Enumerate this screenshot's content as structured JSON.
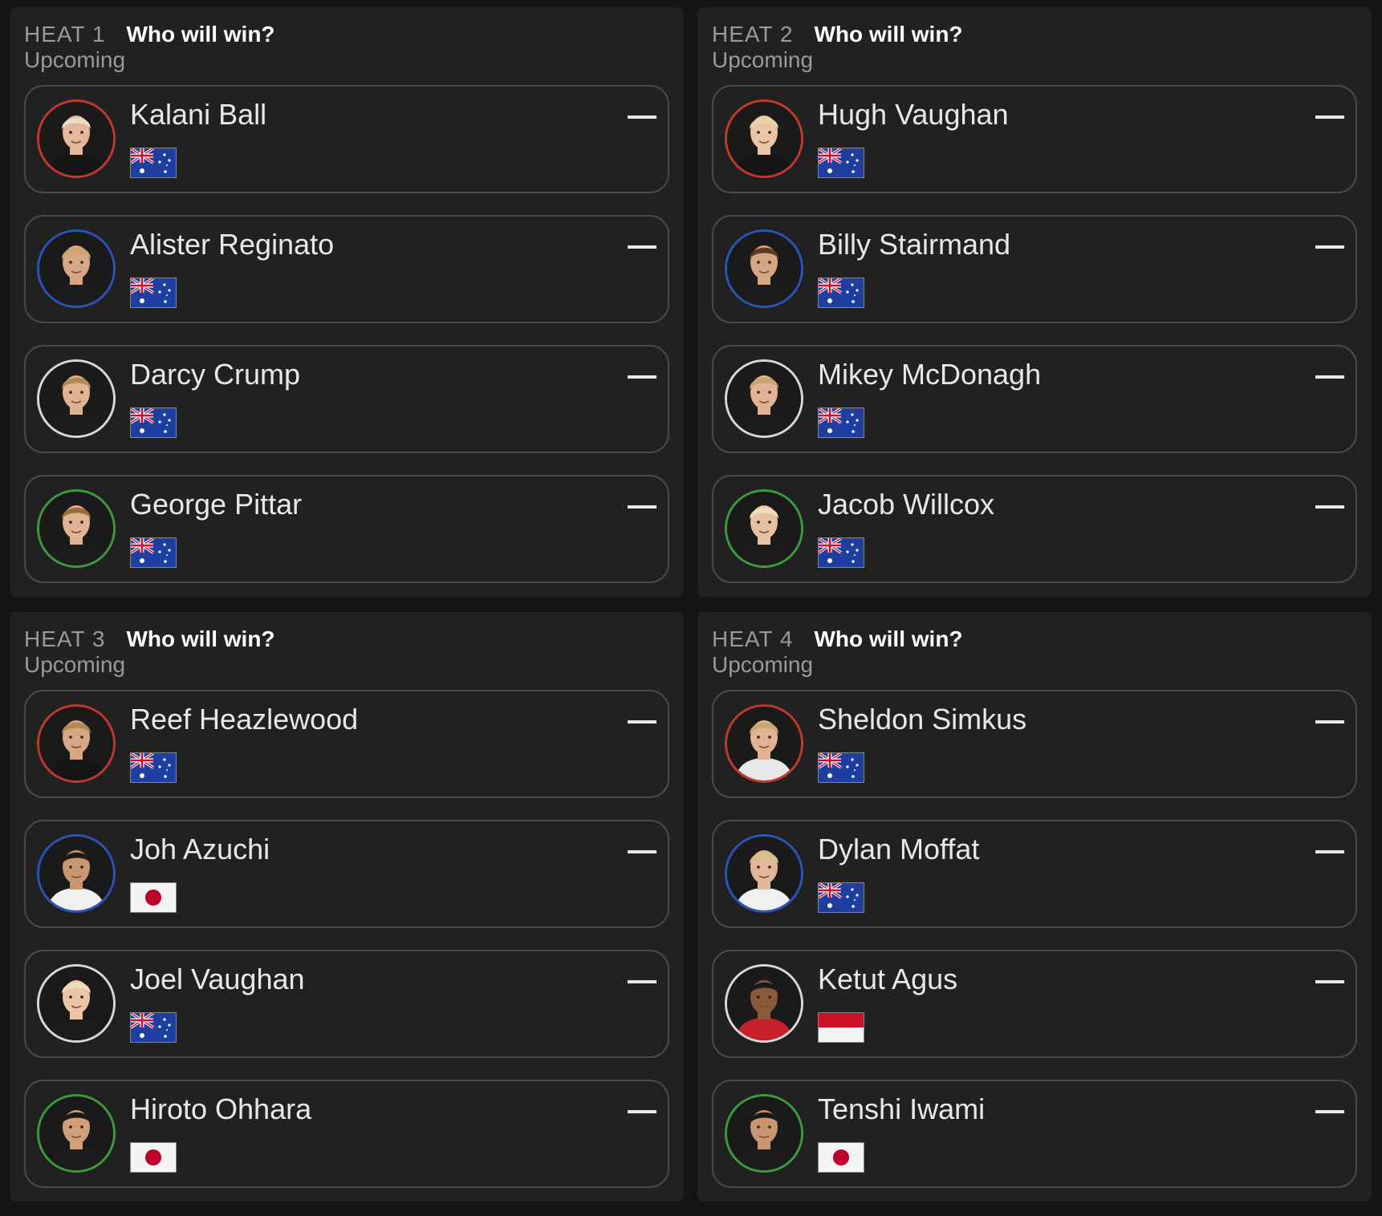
{
  "heats": [
    {
      "label": "HEAT 1",
      "question": "Who will win?",
      "status": "Upcoming",
      "surfers": [
        {
          "name": "Kalani Ball",
          "country": "Australia",
          "ring": "#c0392b",
          "skin": "#e2b79c",
          "hair": "#e8dcc0",
          "shirt": "#151515",
          "pick": "—"
        },
        {
          "name": "Alister Reginato",
          "country": "Australia",
          "ring": "#2a55b8",
          "skin": "#d7a684",
          "hair": "#c9a870",
          "shirt": "#1c1c1c",
          "pick": "—"
        },
        {
          "name": "Darcy Crump",
          "country": "Australia",
          "ring": "#d8d8d8",
          "skin": "#e0b394",
          "hair": "#b38a52",
          "shirt": "#1c1c1c",
          "pick": "—"
        },
        {
          "name": "George Pittar",
          "country": "Australia",
          "ring": "#3c9a3c",
          "skin": "#e0b394",
          "hair": "#9a6a3a",
          "shirt": "#1c1c1c",
          "pick": "—"
        }
      ]
    },
    {
      "label": "HEAT 2",
      "question": "Who will win?",
      "status": "Upcoming",
      "surfers": [
        {
          "name": "Hugh Vaughan",
          "country": "Australia",
          "ring": "#c0392b",
          "skin": "#ecc4a6",
          "hair": "#e5d4a8",
          "shirt": "#151515",
          "pick": "—"
        },
        {
          "name": "Billy Stairmand",
          "country": "Australia",
          "ring": "#2a55b8",
          "skin": "#d7a684",
          "hair": "#5a3a22",
          "shirt": "#1c1c1c",
          "pick": "—"
        },
        {
          "name": "Mikey McDonagh",
          "country": "Australia",
          "ring": "#d8d8d8",
          "skin": "#e0b394",
          "hair": "#c9a870",
          "shirt": "#1c1c1c",
          "pick": "—"
        },
        {
          "name": "Jacob Willcox",
          "country": "Australia",
          "ring": "#3c9a3c",
          "skin": "#e8c0a2",
          "hair": "#ecdfb8",
          "shirt": "#1c1c1c",
          "pick": "—"
        }
      ]
    },
    {
      "label": "HEAT 3",
      "question": "Who will win?",
      "status": "Upcoming",
      "surfers": [
        {
          "name": "Reef Heazlewood",
          "country": "Australia",
          "ring": "#c0392b",
          "skin": "#d7a684",
          "hair": "#b38a52",
          "shirt": "#151515",
          "pick": "—"
        },
        {
          "name": "Joh Azuchi",
          "country": "Japan",
          "ring": "#2a55b8",
          "skin": "#c99672",
          "hair": "#1a1a1a",
          "shirt": "#f0f0f0",
          "pick": "—"
        },
        {
          "name": "Joel Vaughan",
          "country": "Australia",
          "ring": "#d8d8d8",
          "skin": "#ecc4a6",
          "hair": "#ecdfb8",
          "shirt": "#1c1c1c",
          "pick": "—"
        },
        {
          "name": "Hiroto Ohhara",
          "country": "Japan",
          "ring": "#3c9a3c",
          "skin": "#d0a07c",
          "hair": "#1a1a1a",
          "shirt": "#1c1c1c",
          "pick": "—"
        }
      ]
    },
    {
      "label": "HEAT 4",
      "question": "Who will win?",
      "status": "Upcoming",
      "surfers": [
        {
          "name": "Sheldon Simkus",
          "country": "Australia",
          "ring": "#c0392b",
          "skin": "#e0b394",
          "hair": "#c9a870",
          "shirt": "#e8e8e8",
          "pick": "—"
        },
        {
          "name": "Dylan Moffat",
          "country": "Australia",
          "ring": "#2a55b8",
          "skin": "#e2b79c",
          "hair": "#d8c088",
          "shirt": "#f0f0f0",
          "pick": "—"
        },
        {
          "name": "Ketut Agus",
          "country": "Indonesia",
          "ring": "#d8d8d8",
          "skin": "#8a5a3c",
          "hair": "#1a1a1a",
          "shirt": "#c8202a",
          "pick": "—"
        },
        {
          "name": "Tenshi Iwami",
          "country": "Japan",
          "ring": "#3c9a3c",
          "skin": "#c99672",
          "hair": "#1a1a1a",
          "shirt": "#1c1c1c",
          "pick": "—"
        }
      ]
    }
  ]
}
